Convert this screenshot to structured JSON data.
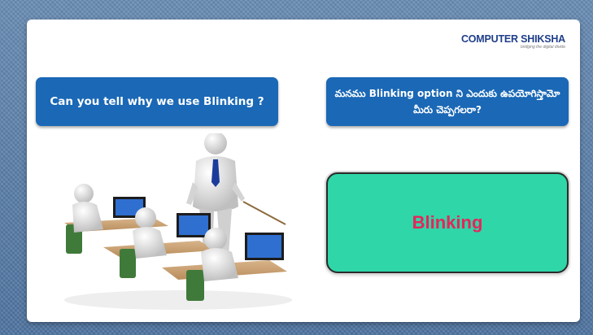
{
  "logo": {
    "name": "COMPUTER SHIKSHA",
    "tagline": "bridging the digital divide"
  },
  "question_english": "Can you tell why we use Blinking ?",
  "question_telugu": "మనము Blinking option ని ఎందుకు ఉపయోగిస్తామో మీరు చెప్పగలరా?",
  "answer": "Blinking",
  "colors": {
    "background": "#5b7fa8",
    "question_box": "#1a68b6",
    "answer_box": "#2fd6a8",
    "answer_text": "#e6255a"
  }
}
